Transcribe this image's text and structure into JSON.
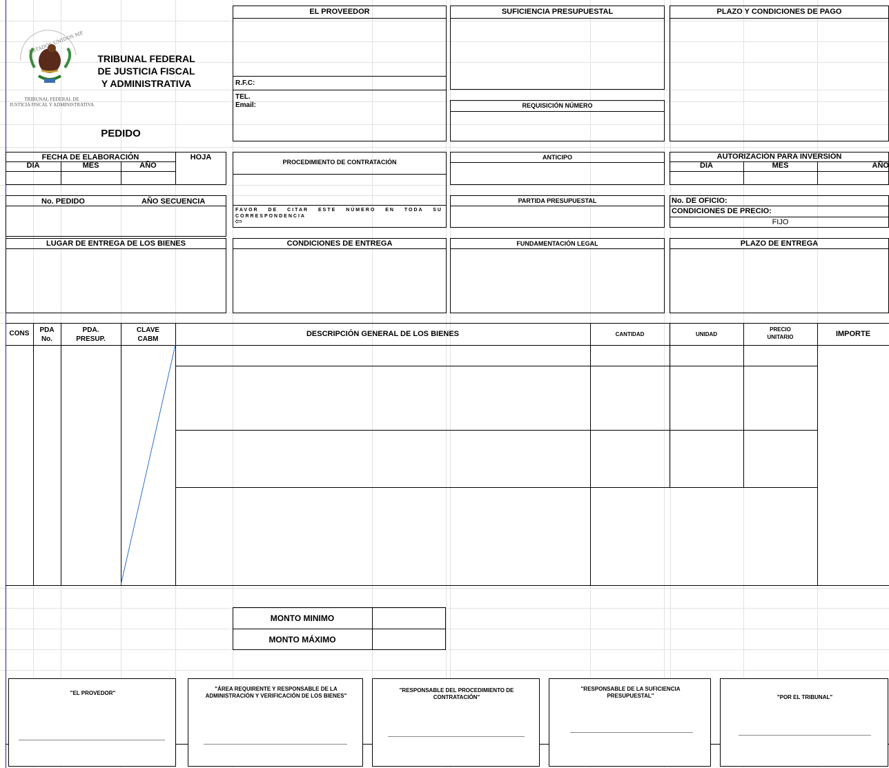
{
  "header": {
    "institution_line1": "TRIBUNAL FEDERAL",
    "institution_line2": "DE JUSTICIA FISCAL",
    "institution_line3": "Y ADMINISTRATIVA",
    "seal_text": "ESTADOS UNIDOS MEXICANOS",
    "seal_caption_line1": "TRIBUNAL FEDERAL DE",
    "seal_caption_line2": "JUSTICIA FISCAL Y ADMINISTRATIVA",
    "document_title": "PEDIDO"
  },
  "proveedor": {
    "title": "EL PROVEEDOR",
    "rfc_label": "R.F.C:",
    "tel_label": "TEL.",
    "email_label": "Email:"
  },
  "suficiencia": {
    "title": "SUFICIENCIA PRESUPUESTAL"
  },
  "requisicion": {
    "title": "REQUISICIÓN NÚMERO"
  },
  "plazo_pago": {
    "title": "PLAZO Y CONDICIONES DE PAGO"
  },
  "fecha": {
    "title": "FECHA DE ELABORACIÓN",
    "dia": "DIA",
    "mes": "MES",
    "anio": "AÑO",
    "hoja": "HOJA"
  },
  "procedimiento": {
    "title": "PROCEDIMIENTO DE CONTRATACIÓN",
    "note": "FAVOR DE CITAR ESTE NÚMERO EN TODA SU CORRESPONDENCIA"
  },
  "anticipo": {
    "title": "ANTICIPO"
  },
  "autorizacion": {
    "title": "AUTORIZACIÓN PARA INVERSIÓN",
    "dia": "DIA",
    "mes": "MES",
    "anio": "AÑO"
  },
  "pedido_no": {
    "label": "No. PEDIDO",
    "secuencia": "AÑO SECUENCIA"
  },
  "partida": {
    "title": "PARTIDA PRESUPUESTAL"
  },
  "oficio": {
    "no_oficio": "No. DE OFICIO:",
    "condiciones_precio": "CONDICIONES DE PRECIO:",
    "precio_tipo": "FIJO"
  },
  "lugar_entrega": {
    "title": "LUGAR DE ENTREGA DE LOS BIENES"
  },
  "condiciones_entrega": {
    "title": "CONDICIONES DE ENTREGA"
  },
  "fundamentacion": {
    "title": "FUNDAMENTACIÓN LEGAL"
  },
  "plazo_entrega": {
    "title": "PLAZO DE ENTREGA"
  },
  "table": {
    "cons": "CONS",
    "pda_no_1": "PDA",
    "pda_no_2": "No.",
    "pda_presup_1": "PDA.",
    "pda_presup_2": "PRESUP.",
    "clave_1": "CLAVE",
    "clave_2": "CABM",
    "descripcion": "DESCRIPCIÓN GENERAL DE LOS BIENES",
    "cantidad": "CANTIDAD",
    "unidad": "UNIDAD",
    "precio_1": "PRECIO",
    "precio_2": "UNITARIO",
    "importe": "IMPORTE"
  },
  "montos": {
    "minimo": "MONTO MINIMO",
    "maximo": "MONTO MÁXIMO"
  },
  "firmas": [
    {
      "label": "\"EL PROVEDOR\""
    },
    {
      "label": "\"ÁREA REQUIRENTE  Y RESPONSABLE DE LA ADMINISTRACIÓN Y VERIFICACIÓN DE LOS BIENES\""
    },
    {
      "label": "\"RESPONSABLE  DEL PROCEDIMIENTO  DE CONTRATACIÓN\""
    },
    {
      "label": "\"RESPONSABLE  DE LA SUFICIENCIA PRESUPUESTAL\""
    },
    {
      "label": "\"POR EL  TRIBUNAL\""
    }
  ]
}
